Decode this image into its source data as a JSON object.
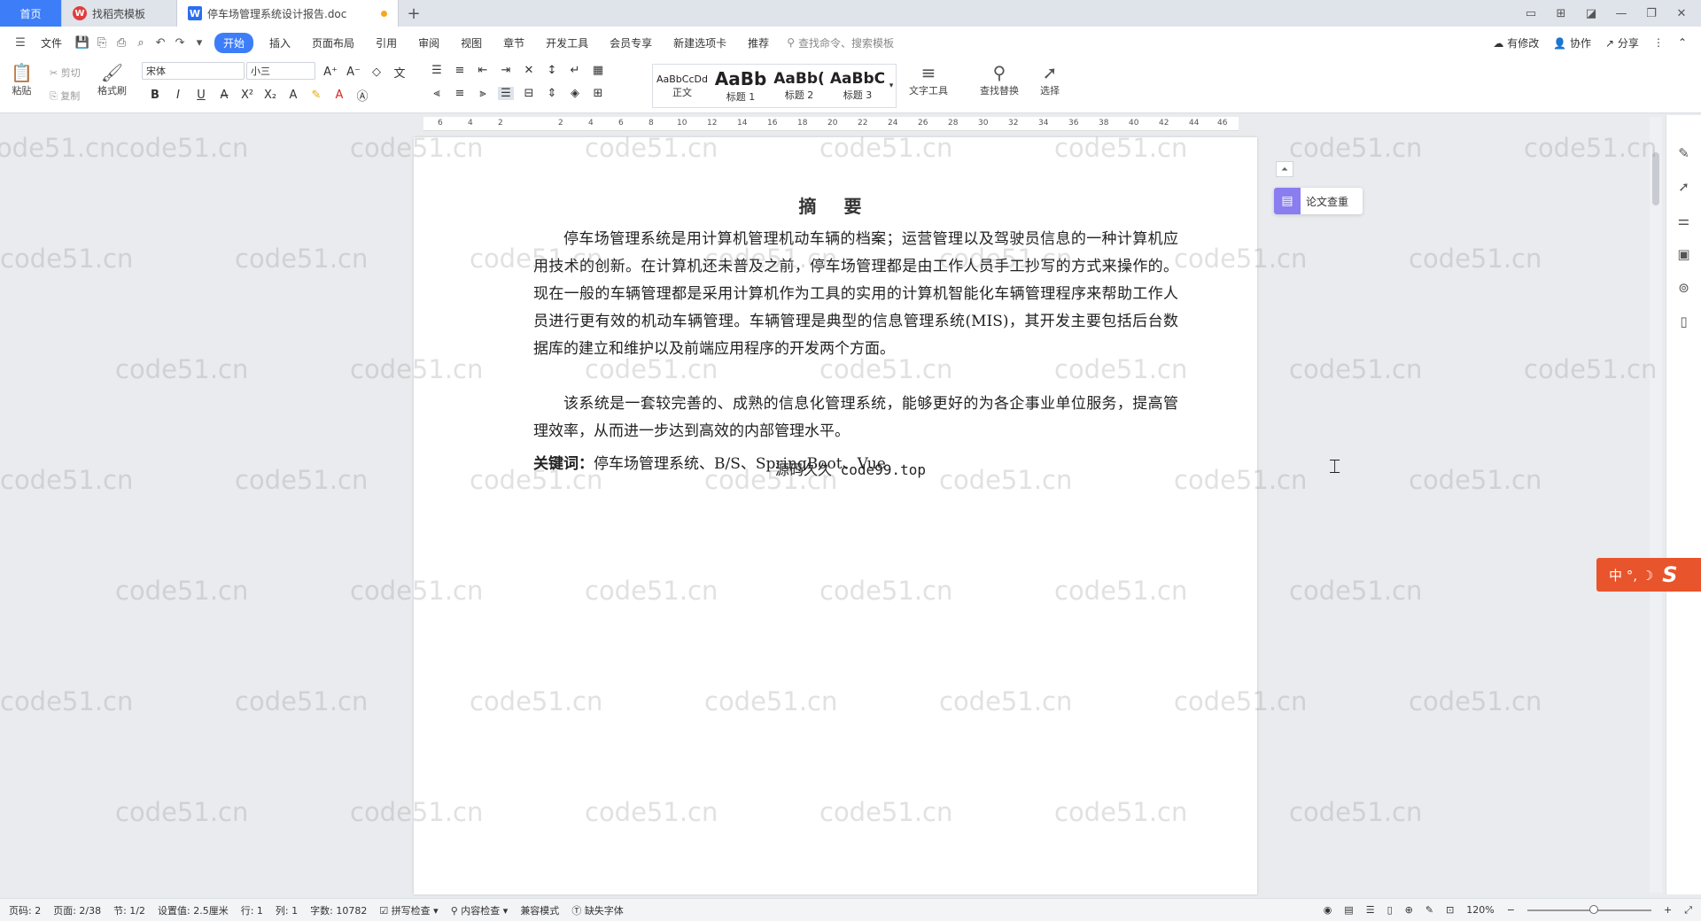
{
  "tabs": {
    "home": "首页",
    "template": "找稻壳模板",
    "document": "停车场管理系统设计报告.doc",
    "new_tab": "+"
  },
  "menu": {
    "file": "文件",
    "items": [
      "开始",
      "插入",
      "页面布局",
      "引用",
      "审阅",
      "视图",
      "章节",
      "开发工具",
      "会员专享",
      "新建选项卡",
      "推荐"
    ],
    "search_placeholder": "查找命令、搜索模板",
    "has_changes": "有修改",
    "collaborate": "协作",
    "share": "分享"
  },
  "ribbon": {
    "paste": "粘贴",
    "cut": "剪切",
    "copy": "复制",
    "format_painter": "格式刷",
    "font_name": "宋体",
    "font_size": "小三",
    "styles": [
      {
        "sample": "AaBbCcDd",
        "name": "正文"
      },
      {
        "sample": "AaBb",
        "name": "标题 1"
      },
      {
        "sample": "AaBb(",
        "name": "标题 2"
      },
      {
        "sample": "AaBbC",
        "name": "标题 3"
      }
    ],
    "text_tools": "文字工具",
    "find_replace": "查找替换",
    "select": "选择"
  },
  "ruler": {
    "ticks": [
      "6",
      "4",
      "2",
      "2",
      "4",
      "6",
      "8",
      "10",
      "12",
      "14",
      "16",
      "18",
      "20",
      "22",
      "24",
      "26",
      "28",
      "30",
      "32",
      "34",
      "36",
      "38",
      "40",
      "42",
      "44",
      "46"
    ]
  },
  "document": {
    "title": "摘  要",
    "paragraph1": "停车场管理系统是用计算机管理机动车辆的档案；运营管理以及驾驶员信息的一种计算机应用技术的创新。在计算机还未普及之前，停车场管理都是由工作人员手工抄写的方式来操作的。现在一般的车辆管理都是采用计算机作为工具的实用的计算机智能化车辆管理程序来帮助工作人员进行更有效的机动车辆管理。车辆管理是典型的信息管理系统(MIS)，其开发主要包括后台数据库的建立和维护以及前端应用程序的开发两个方面。",
    "paragraph2": "该系统是一套较完善的、成熟的信息化管理系统，能够更好的为各企事业单位服务，提高管理效率，从而进一步达到高效的内部管理水平。",
    "keywords_label": "关键词：",
    "keywords": "停车场管理系统、B/S、SpringBoot、Vue",
    "overlay": "源码久久 code99.top"
  },
  "side": {
    "paper_check": "论文查重"
  },
  "ime": {
    "label": "中 °, ☽"
  },
  "watermark": "code51.cn",
  "status": {
    "page_num": "页码: 2",
    "pages": "页面: 2/38",
    "section": "节: 1/2",
    "setting": "设置值: 2.5厘米",
    "row": "行: 1",
    "col": "列: 1",
    "word_count": "字数: 10782",
    "spell_check": "拼写检查",
    "content_check": "内容检查",
    "compat_mode": "兼容模式",
    "missing_font": "缺失字体",
    "zoom": "120%"
  },
  "colors": {
    "accent": "#3d7ef8",
    "ime": "#e8542b",
    "paper_check_icon": "#8a7df0"
  }
}
